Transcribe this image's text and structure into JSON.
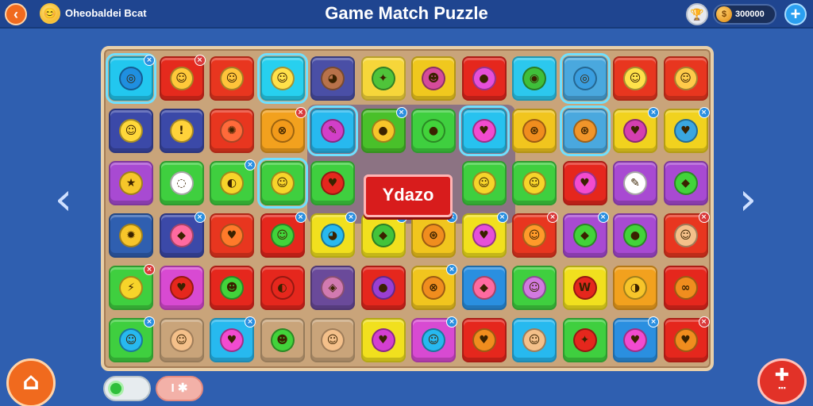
{
  "header": {
    "title": "Game Match Puzzle",
    "player_name": "Oheobaldei Bcat",
    "coins": "300000",
    "back_icon": "arrow-left-icon",
    "avatar_glyph": "😊",
    "trophy_glyph": "🏆",
    "coin_glyph": "$",
    "add_glyph": "+"
  },
  "nav": {
    "prev_glyph": "‹",
    "next_glyph": "›"
  },
  "board": {
    "banner_text": "Ydazo",
    "rows": [
      [
        {
          "c": "#22c7ef",
          "g": "◎",
          "fc": "#1f8fe0",
          "b": "blue",
          "s": true
        },
        {
          "c": "#e52a1d",
          "g": "☺",
          "fc": "#ffc93a",
          "b": "red"
        },
        {
          "c": "#e8361f",
          "g": "☺",
          "fc": "#ffc33a"
        },
        {
          "c": "#27d0ef",
          "g": "☺",
          "fc": "#ffe14a",
          "s": true
        },
        {
          "c": "#4a4fa6",
          "g": "◕",
          "fc": "#b8724a"
        },
        {
          "c": "#f6d63a",
          "g": "✦",
          "fc": "#4fc43a"
        },
        {
          "c": "#f0c81e",
          "g": "☻",
          "fc": "#d54b9b"
        },
        {
          "c": "#e5271d",
          "g": "●",
          "fc": "#e64fd9"
        },
        {
          "c": "#2cc8ee",
          "g": "◉",
          "fc": "#3fbf3a"
        },
        {
          "c": "#4aa8de",
          "g": "◎",
          "fc": "#3a9ee0",
          "s": true
        },
        {
          "c": "#e8361f",
          "g": "☺",
          "fc": "#ffe14a"
        },
        {
          "c": "#e8361f",
          "g": "☺",
          "fc": "#ffcb4a"
        }
      ],
      [
        {
          "c": "#3b49a8",
          "g": "☺",
          "fc": "#ffd83a"
        },
        {
          "c": "#3b49a8",
          "g": "!",
          "fc": "#ffd23a"
        },
        {
          "c": "#e8361f",
          "g": "✺",
          "fc": "#ff6a3a"
        },
        {
          "c": "#f2a11e",
          "g": "⊗",
          "fc": "#f29a1a",
          "b": "red"
        },
        {
          "c": "#27b9ef",
          "g": "✎",
          "fc": "#d23fc8",
          "s": true
        },
        {
          "c": "#49c02a",
          "g": "●",
          "fc": "#f7c52a",
          "b": "blue"
        },
        {
          "c": "#3fcf3f",
          "g": "●",
          "fc": "#42d33a"
        },
        {
          "c": "#27c2ef",
          "g": "♥",
          "fc": "#f24bd0",
          "s": true
        },
        {
          "c": "#f1c51e",
          "g": "⊛",
          "fc": "#f08d1e"
        },
        {
          "c": "#4aa8de",
          "g": "⊛",
          "fc": "#f0952a",
          "s": true
        },
        {
          "c": "#f1d21e",
          "g": "♥",
          "fc": "#d43fb0",
          "b": "blue"
        },
        {
          "c": "#f1d21e",
          "g": "♥",
          "fc": "#3aa6e0",
          "b": "blue"
        }
      ],
      [
        {
          "c": "#a84ad2",
          "g": "★",
          "fc": "#f6c62a"
        },
        {
          "c": "#3fcf3f",
          "g": "◌",
          "fc": "#ffffff"
        },
        {
          "c": "#3fcf3f",
          "g": "◐",
          "fc": "#f7d42a",
          "b": "blue"
        },
        {
          "c": "#3fcf3f",
          "g": "☺",
          "fc": "#f7d42a",
          "s": true
        },
        {
          "c": "#3fcf3f",
          "g": "♥",
          "fc": "#e5271d"
        },
        {
          "c": "#3fcf3f",
          "g": "☺",
          "fc": "#f7d42a",
          "hide": true
        },
        {
          "c": "#3fcf3f",
          "g": "☺",
          "fc": "#f7d42a",
          "hide": true
        },
        {
          "c": "#3fcf3f",
          "g": "☺",
          "fc": "#f7d42a"
        },
        {
          "c": "#3fcf3f",
          "g": "☺",
          "fc": "#f7d42a"
        },
        {
          "c": "#e5271d",
          "g": "♥",
          "fc": "#f24bd0"
        },
        {
          "c": "#a84ad2",
          "g": "✎",
          "fc": "#ffffff"
        },
        {
          "c": "#a84ad2",
          "g": "◆",
          "fc": "#42d33a"
        }
      ],
      [
        {
          "c": "#2f5fb0",
          "g": "✹",
          "fc": "#f7c52a"
        },
        {
          "c": "#3b49a8",
          "g": "◆",
          "fc": "#ff6aa0",
          "b": "blue"
        },
        {
          "c": "#e8361f",
          "g": "♥",
          "fc": "#ff7a2a"
        },
        {
          "c": "#e5271d",
          "g": "☺",
          "fc": "#42d33a",
          "b": "blue"
        },
        {
          "c": "#f1e01e",
          "g": "◕",
          "fc": "#27b9ef",
          "b": "blue"
        },
        {
          "c": "#f1e01e",
          "g": "◆",
          "fc": "#42c33a",
          "b": "blue"
        },
        {
          "c": "#f1c51e",
          "g": "⊛",
          "fc": "#f08d1e",
          "b": "blue"
        },
        {
          "c": "#f1e01e",
          "g": "♥",
          "fc": "#e64fd9",
          "b": "blue"
        },
        {
          "c": "#e8361f",
          "g": "☺",
          "fc": "#ff9a2a",
          "b": "red"
        },
        {
          "c": "#a84ad2",
          "g": "◆",
          "fc": "#42d33a",
          "b": "blue"
        },
        {
          "c": "#a84ad2",
          "g": "●",
          "fc": "#42d33a"
        },
        {
          "c": "#e8361f",
          "g": "☺",
          "fc": "#f4c08a",
          "b": "red"
        }
      ],
      [
        {
          "c": "#3fcf3f",
          "g": "⚡",
          "fc": "#f7d42a",
          "b": "red"
        },
        {
          "c": "#d84ad2",
          "g": "♥",
          "fc": "#e5271d"
        },
        {
          "c": "#e5271d",
          "g": "☻",
          "fc": "#42d33a"
        },
        {
          "c": "#e5271d",
          "g": "◐",
          "fc": "#e5271d"
        },
        {
          "c": "#6a4a9a",
          "g": "◈",
          "fc": "#d27ab0"
        },
        {
          "c": "#e5271d",
          "g": "●",
          "fc": "#9a3fd2"
        },
        {
          "c": "#f1c51e",
          "g": "⊗",
          "fc": "#f08d1e",
          "b": "blue"
        },
        {
          "c": "#2a8fe0",
          "g": "◆",
          "fc": "#ff6aa0"
        },
        {
          "c": "#3fcf3f",
          "g": "☺",
          "fc": "#d27ae0"
        },
        {
          "c": "#f1e01e",
          "g": "W",
          "fc": "#e5271d"
        },
        {
          "c": "#f2a11e",
          "g": "◑",
          "fc": "#f7c52a"
        },
        {
          "c": "#e5271d",
          "g": "∞",
          "fc": "#f08d1e"
        }
      ],
      [
        {
          "c": "#3fcf3f",
          "g": "☺",
          "fc": "#27b9ef",
          "b": "blue"
        },
        {
          "c": "#c9a47a",
          "g": "☺",
          "fc": "#f4c08a"
        },
        {
          "c": "#27b9ef",
          "g": "♥",
          "fc": "#f24bd0",
          "b": "blue"
        },
        {
          "c": "#c9a47a",
          "g": "☻",
          "fc": "#42d33a"
        },
        {
          "c": "#c9a47a",
          "g": "☺",
          "fc": "#f4c08a"
        },
        {
          "c": "#f1e01e",
          "g": "♥",
          "fc": "#d43fd0"
        },
        {
          "c": "#d84ad2",
          "g": "☺",
          "fc": "#27b9ef",
          "b": "blue"
        },
        {
          "c": "#e5271d",
          "g": "♥",
          "fc": "#f08d1e"
        },
        {
          "c": "#27b9ef",
          "g": "☺",
          "fc": "#f4c08a"
        },
        {
          "c": "#3fcf3f",
          "g": "✦",
          "fc": "#e5271d"
        },
        {
          "c": "#2a8fe0",
          "g": "♥",
          "fc": "#f24bd0",
          "b": "blue"
        },
        {
          "c": "#e5271d",
          "g": "♥",
          "fc": "#f08d1e",
          "b": "red"
        }
      ]
    ]
  },
  "footer": {
    "home_glyph": "⌂",
    "toggle_state": "on",
    "pill_label": "I ✱",
    "menu_glyph": "✚",
    "menu_label": "▪▪▪"
  }
}
